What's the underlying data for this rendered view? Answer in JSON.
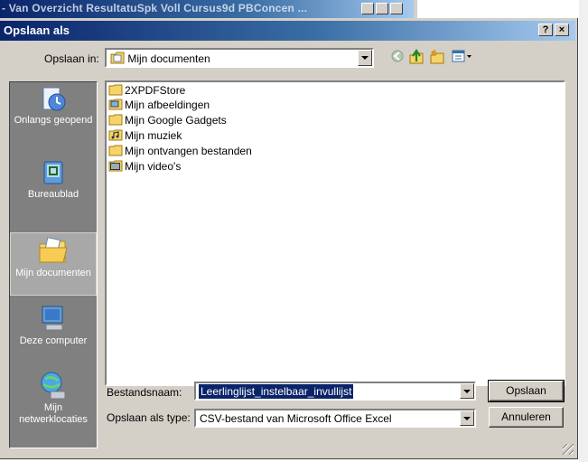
{
  "background_window": {
    "title": "- Van Overzicht ResultatuSpk Voll Cursus9d PBConcen ..."
  },
  "dialog": {
    "title": "Opslaan als",
    "help_button": "?",
    "close_button": "×"
  },
  "save_in": {
    "label": "Opslaan in:",
    "value": "Mijn documenten"
  },
  "toolbar": {
    "icons": [
      "back-icon",
      "up-folder-icon",
      "new-folder-icon",
      "views-menu-icon"
    ]
  },
  "places": [
    {
      "label": "Onlangs geopend",
      "icon": "recent-icon"
    },
    {
      "label": "Bureaublad",
      "icon": "desktop-icon"
    },
    {
      "label": "Mijn documenten",
      "icon": "my-documents-icon",
      "selected": true
    },
    {
      "label": "Deze computer",
      "icon": "my-computer-icon"
    },
    {
      "label": "Mijn netwerklocaties",
      "icon": "network-icon"
    }
  ],
  "files": [
    {
      "name": "2XPDFStore",
      "icon": "folder-icon"
    },
    {
      "name": "Mijn afbeeldingen",
      "icon": "pictures-folder-icon"
    },
    {
      "name": "Mijn Google Gadgets",
      "icon": "folder-icon"
    },
    {
      "name": "Mijn muziek",
      "icon": "music-folder-icon"
    },
    {
      "name": "Mijn ontvangen bestanden",
      "icon": "folder-icon"
    },
    {
      "name": "Mijn video's",
      "icon": "video-folder-icon"
    }
  ],
  "filename": {
    "label": "Bestandsnaam:",
    "value": "Leerlinglijst_instelbaar_invullijst"
  },
  "filetype": {
    "label": "Opslaan als type:",
    "value": "CSV-bestand van Microsoft Office Excel"
  },
  "buttons": {
    "save": "Opslaan",
    "cancel": "Annuleren"
  },
  "colors": {
    "titlebar": "#0a246a",
    "face": "#d4d0c8",
    "selection": "#0a246a"
  }
}
